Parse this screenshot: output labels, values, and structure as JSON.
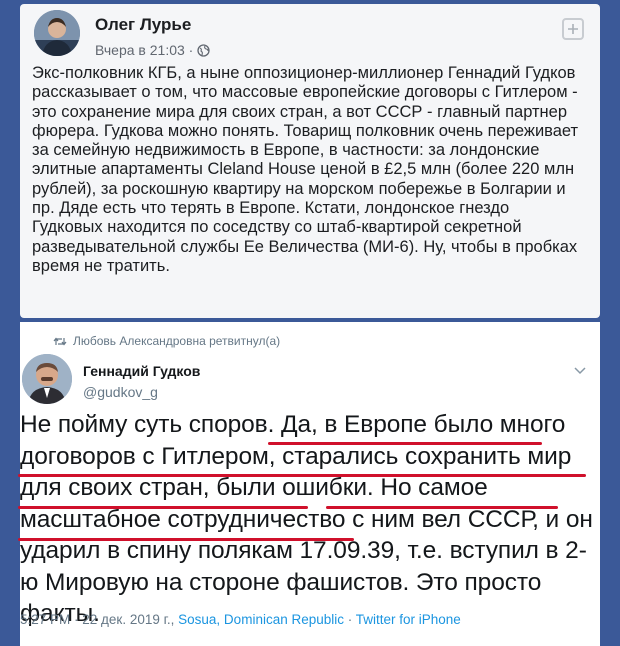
{
  "facebook_post": {
    "author": "Олег Лурье",
    "timestamp": "Вчера в 21:03 ·",
    "privacy_icon": "globe-icon",
    "text": "Экс-полковник КГБ, а ныне оппозиционер-миллионер Геннадий Гудков рассказывает о том, что массовые европейские договоры с Гитлером - это сохранение мира для своих стран, а вот СССР - главный партнер фюрера. Гудкова можно понять. Товарищ полковник очень переживает за семейную недвижимость в Европе, в частности: за лондонские элитные апартаменты Cleland House ценой в £2,5 млн (более 220 млн рублей), за роскошную квартиру на морском побережье в Болгарии и пр. Дяде есть что терять в Европе. Кстати, лондонское гнездо Гудковых находится по соседству со штаб-квартирой секретной разведывательной службы Ее Величества (МИ-6). Ну, чтобы в пробках время не тратить."
  },
  "tweet": {
    "retweeted_by": "Любовь Александровна ретвитнул(а)",
    "author_name": "Геннадий Гудков",
    "handle": "@gudkov_g",
    "text_parts": [
      "Не пойму суть споров. ",
      "Да, в Европе было много договоров с Гитлером, старались сохранить мир для своих стран, были ошибки.",
      " ",
      "Но самое масштабное сотрудничество с ним вел СССР",
      ", и он ударил в спину полякам 17.09.39, т.е. вступил в 2-ю Мировую на стороне фашистов. Это просто факты."
    ],
    "meta_time": "5:27 PM · 22 дек. 2019 г., ",
    "location": "Sosua, Dominican Republic",
    "separator": " · ",
    "source": "Twitter for iPhone"
  },
  "colors": {
    "background": "#3b5998",
    "underline": "#d0102b",
    "link": "#1b95e0"
  }
}
